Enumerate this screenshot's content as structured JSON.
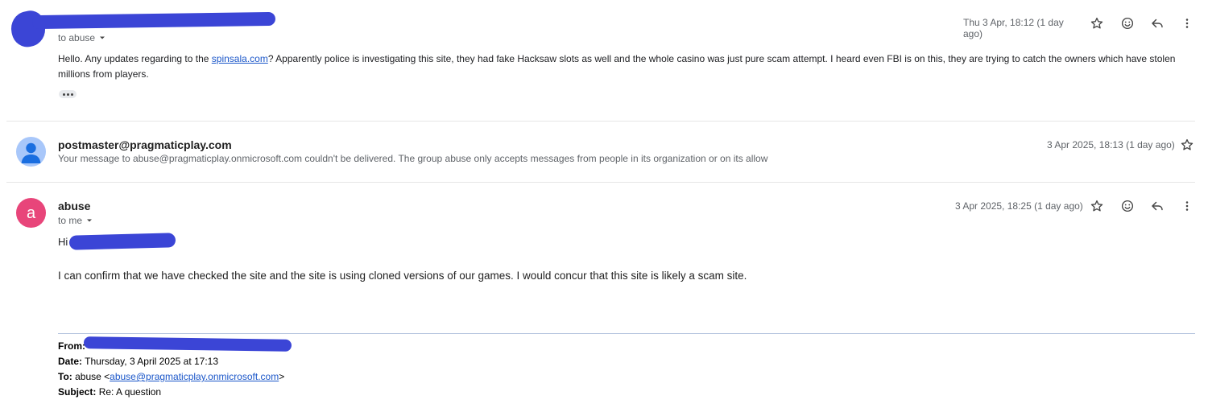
{
  "message1": {
    "to_label": "to abuse",
    "timestamp": "Thu 3 Apr, 18:12 (1 day ago)",
    "body_before_link": "Hello. Any updates regarding to the ",
    "link_text": "spinsala.com",
    "body_after_link": "? Apparently police is investigating this site, they had fake Hacksaw slots as well and the whole casino was just pure scam attempt. I heard even FBI is on this, they are trying to catch the owners which have stolen millions from players."
  },
  "message2": {
    "sender": "postmaster@pragmaticplay.com",
    "snippet": "Your message to abuse@pragmaticplay.onmicrosoft.com couldn't be delivered. The group abuse only accepts messages from people in its organization or on its allow",
    "timestamp": "3 Apr 2025, 18:13 (1 day ago)"
  },
  "message3": {
    "avatar_letter": "a",
    "sender": "abuse",
    "to_label": "to me",
    "timestamp": "3 Apr 2025, 18:25 (1 day ago)",
    "greeting": "Hi",
    "body": "I can confirm that we have checked the site and the site is using cloned versions of our games. I would concur that this site is likely a scam site.",
    "quoted": {
      "from_label": "From:",
      "date_label": "Date:",
      "date_value": "Thursday, 3 April 2025 at 17:13",
      "to_label": "To:",
      "to_name": "abuse <",
      "to_email": "abuse@pragmaticplay.onmicrosoft.com",
      "to_close": ">",
      "subject_label": "Subject:",
      "subject_value": "Re: A question"
    }
  },
  "colors": {
    "avatar_abuse": "#e8457a",
    "avatar_default": "#a8c7fa",
    "link": "#1a56c9",
    "redaction": "#3b45d6"
  },
  "icons": [
    "star-icon",
    "emoji-icon",
    "reply-icon",
    "more-vert-icon",
    "chevron-down-icon"
  ]
}
